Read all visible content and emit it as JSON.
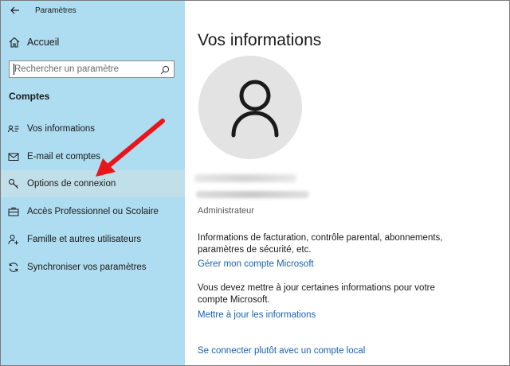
{
  "window": {
    "title": "Paramètres"
  },
  "sidebar": {
    "home_label": "Accueil",
    "search": {
      "placeholder": "Rechercher un paramètre",
      "value": ""
    },
    "section_title": "Comptes",
    "items": [
      {
        "label": "Vos informations",
        "icon": "person-card-icon",
        "active": false
      },
      {
        "label": "E-mail et comptes",
        "icon": "mail-icon",
        "active": false
      },
      {
        "label": "Options de connexion",
        "icon": "key-icon",
        "active": true
      },
      {
        "label": "Accès Professionnel ou Scolaire",
        "icon": "briefcase-icon",
        "active": false
      },
      {
        "label": "Famille et autres utilisateurs",
        "icon": "add-person-icon",
        "active": false
      },
      {
        "label": "Synchroniser vos paramètres",
        "icon": "sync-icon",
        "active": false
      }
    ]
  },
  "main": {
    "title": "Vos informations",
    "role": "Administrateur",
    "billing_text": "Informations de facturation, contrôle parental, abonnements, paramètres de sécurité, etc.",
    "manage_link": "Gérer mon compte Microsoft",
    "update_text": "Vous devez mettre à jour certaines informations pour votre compte Microsoft.",
    "update_link": "Mettre à jour les informations",
    "local_account_link": "Se connecter plutôt avec un compte local"
  },
  "colors": {
    "sidebar_bg": "#aedcf0",
    "active_item_bg": "#c1dfe9",
    "link": "#1762b3",
    "annotation_arrow": "#e8161b"
  }
}
